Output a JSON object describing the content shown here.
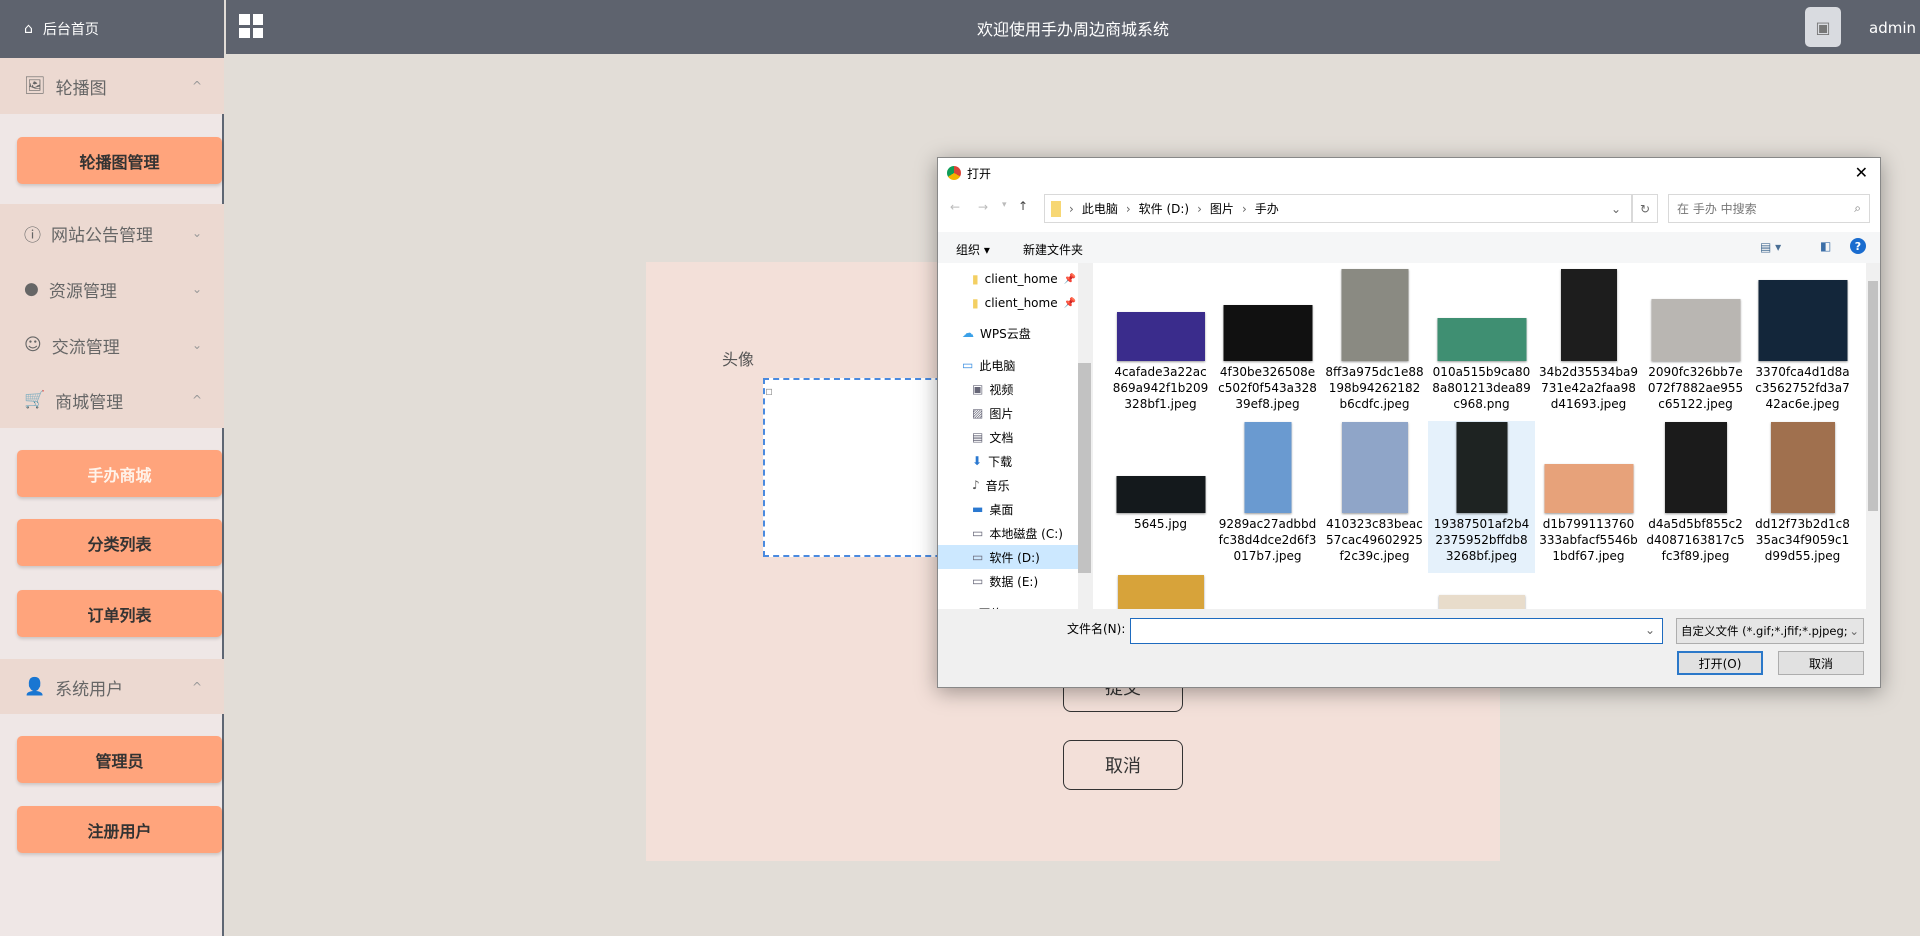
{
  "sidebar": {
    "home": "后台首页",
    "sections": [
      {
        "label": "轮播图",
        "icon": "picture-icon",
        "expanded": true,
        "items": [
          "轮播图管理"
        ]
      },
      {
        "label": "网站公告管理",
        "icon": "info-icon",
        "expanded": false
      },
      {
        "label": "资源管理",
        "icon": "bulb-icon",
        "expanded": false
      },
      {
        "label": "交流管理",
        "icon": "chat-icon",
        "expanded": false
      },
      {
        "label": "商城管理",
        "icon": "cart-icon",
        "expanded": true,
        "items": [
          "手办商城",
          "分类列表",
          "订单列表"
        ],
        "active": "手办商城"
      },
      {
        "label": "系统用户",
        "icon": "user-icon",
        "expanded": true,
        "items": [
          "管理员",
          "注册用户"
        ]
      }
    ]
  },
  "header": {
    "title": "欢迎使用手办周边商城系统",
    "user": "admin"
  },
  "form": {
    "avatar_label": "头像",
    "submit": "提交",
    "cancel": "取消"
  },
  "dialog": {
    "title": "打开",
    "breadcrumb": [
      "此电脑",
      "软件 (D:)",
      "图片",
      "手办"
    ],
    "search_placeholder": "在 手办 中搜索",
    "organize": "组织 ▾",
    "new_folder": "新建文件夹",
    "nav": [
      {
        "label": "client_home",
        "icon": "folder-icon",
        "pinned": true
      },
      {
        "label": "client_home",
        "icon": "folder-icon",
        "pinned": true
      },
      {
        "label": "WPS云盘",
        "icon": "cloud-icon"
      },
      {
        "label": "此电脑",
        "icon": "computer-icon"
      },
      {
        "label": "视频",
        "icon": "video-icon"
      },
      {
        "label": "图片",
        "icon": "pictures-icon"
      },
      {
        "label": "文档",
        "icon": "document-icon"
      },
      {
        "label": "下载",
        "icon": "download-icon"
      },
      {
        "label": "音乐",
        "icon": "music-icon"
      },
      {
        "label": "桌面",
        "icon": "desktop-icon"
      },
      {
        "label": "本地磁盘 (C:)",
        "icon": "drive-icon"
      },
      {
        "label": "软件 (D:)",
        "icon": "drive-icon",
        "selected": true
      },
      {
        "label": "数据 (E:)",
        "icon": "drive-icon"
      },
      {
        "label": "网络",
        "icon": "network-icon"
      }
    ],
    "files": [
      {
        "name": "4cafade3a22ac869a942f1b209328bf1.jpeg",
        "color": "#3a2c8c"
      },
      {
        "name": "4f30be326508ec502f0f543a32839ef8.jpeg",
        "color": "#111111"
      },
      {
        "name": "8ff3a975dc1e88198b94262182b6cdfc.jpeg",
        "color": "#8a8a82"
      },
      {
        "name": "010a515b9ca808a801213dea89c968.png",
        "color": "#3f8f72"
      },
      {
        "name": "34b2d35534ba9731e42a2faa98d41693.jpeg",
        "color": "#1d1d1d"
      },
      {
        "name": "2090fc326bb7e072f7882ae955c65122.jpeg",
        "color": "#b9b6b2"
      },
      {
        "name": "3370fca4d1d8ac3562752fd3a742ac6e.jpeg",
        "color": "#13263a"
      },
      {
        "name": "5645.jpg",
        "color": "#14191c"
      },
      {
        "name": "9289ac27adbbdfc38d4dce2d6f3017b7.jpeg",
        "color": "#6a9ad0"
      },
      {
        "name": "410323c83beac57cac49602925f2c39c.jpeg",
        "color": "#8fa5c8"
      },
      {
        "name": "19387501af2b42375952bffdb83268bf.jpeg",
        "color": "#1e2322",
        "selected": true
      },
      {
        "name": "d1b799113760333abfacf5546b1bdf67.jpeg",
        "color": "#e7a27a"
      },
      {
        "name": "d4a5d5bf855c2d4087163817c5fc3f89.jpeg",
        "color": "#1b1b1b"
      },
      {
        "name": "dd12f73b2d1c835ac34f9059c1d99d55.jpeg",
        "color": "#a0704e"
      },
      {
        "name": "",
        "color": "#d7a33a"
      },
      {
        "name": "",
        "color": "#fff"
      },
      {
        "name": "",
        "color": "#fff"
      },
      {
        "name": "",
        "color": "#e8dccb"
      }
    ],
    "filename_label": "文件名(N):",
    "filename_value": "",
    "filter": "自定义文件 (*.gif;*.jfif;*.pjpeg;",
    "open": "打开(O)",
    "cancel": "取消"
  }
}
